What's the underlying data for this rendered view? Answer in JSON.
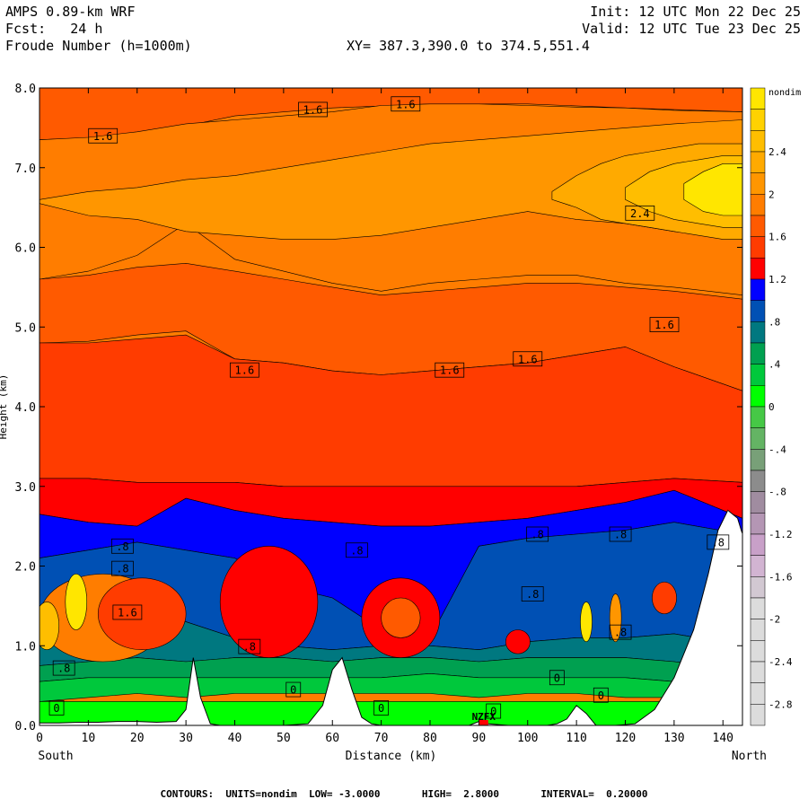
{
  "header": {
    "model": "AMPS 0.89-km WRF",
    "forecast": "Fcst:   24 h",
    "field": "Froude Number (h=1000m)",
    "init": "Init: 12 UTC Mon 22 Dec 25",
    "valid": "Valid: 12 UTC Tue 23 Dec 25",
    "xy": "XY= 387.3,390.0 to 374.5,551.4"
  },
  "chart_data": {
    "type": "heatmap",
    "title": "Froude Number (h=1000m)",
    "xlabel": "Distance (km)",
    "ylabel": "Height (km)",
    "x_ticks": [
      0,
      10,
      20,
      30,
      40,
      50,
      60,
      70,
      80,
      90,
      100,
      110,
      120,
      130,
      140
    ],
    "y_ticks": [
      "0.0",
      "1.0",
      "2.0",
      "3.0",
      "4.0",
      "5.0",
      "6.0",
      "7.0",
      "8.0"
    ],
    "xlim": [
      0,
      144
    ],
    "ylim": [
      0,
      8
    ],
    "left_end_label": "South",
    "right_end_label": "North",
    "station_label": "NZFX",
    "station_x": 91,
    "colorbar": {
      "unit": "nondim",
      "labels": [
        "2.4",
        "2",
        "1.6",
        "1.2",
        ".8",
        ".4",
        "0",
        "-.4",
        "-.8",
        "-1.2",
        "-1.6",
        "-2",
        "-2.4",
        "-2.8"
      ],
      "levels": [
        {
          "value": 2.8,
          "color": "#ffe600"
        },
        {
          "value": 2.6,
          "color": "#ffd200"
        },
        {
          "value": 2.4,
          "color": "#ffbe00"
        },
        {
          "value": 2.2,
          "color": "#ffaa00"
        },
        {
          "value": 2.0,
          "color": "#ff9600"
        },
        {
          "value": 1.8,
          "color": "#ff7d00"
        },
        {
          "value": 1.6,
          "color": "#ff5a00"
        },
        {
          "value": 1.4,
          "color": "#ff3c00"
        },
        {
          "value": 1.2,
          "color": "#ff0000"
        },
        {
          "value": 1.0,
          "color": "#0000ff"
        },
        {
          "value": 0.8,
          "color": "#0050b4"
        },
        {
          "value": 0.6,
          "color": "#007880"
        },
        {
          "value": 0.4,
          "color": "#00a050"
        },
        {
          "value": 0.2,
          "color": "#00c83c"
        },
        {
          "value": 0.0,
          "color": "#00ff00"
        },
        {
          "value": -0.2,
          "color": "#46c846"
        },
        {
          "value": -0.4,
          "color": "#64b464"
        },
        {
          "value": -0.6,
          "color": "#78a078"
        },
        {
          "value": -0.8,
          "color": "#8c8c8c"
        },
        {
          "value": -1.0,
          "color": "#a08ca0"
        },
        {
          "value": -1.2,
          "color": "#b496b4"
        },
        {
          "value": -1.4,
          "color": "#c8a0c8"
        },
        {
          "value": -1.6,
          "color": "#d2b4d2"
        },
        {
          "value": -1.8,
          "color": "#d2c8d2"
        },
        {
          "value": -2.0,
          "color": "#dcdcdc"
        },
        {
          "value": -2.2,
          "color": "#dcdcdc"
        },
        {
          "value": -2.4,
          "color": "#dcdcdc"
        },
        {
          "value": -2.6,
          "color": "#dcdcdc"
        },
        {
          "value": -2.8,
          "color": "#dcdcdc"
        },
        {
          "value": -3.0,
          "color": "#dcdcdc"
        }
      ]
    },
    "bands": [
      {
        "name": "upper-1.6-band",
        "value": 1.6,
        "color": "#ff5a00",
        "x": [
          0,
          20,
          40,
          60,
          80,
          100,
          120,
          144
        ],
        "top": [
          8.0,
          8.0,
          8.0,
          8.0,
          8.0,
          8.0,
          8.0,
          8.0
        ],
        "bottom": [
          7.35,
          7.4,
          7.65,
          7.75,
          7.8,
          7.8,
          7.75,
          7.7
        ]
      },
      {
        "name": "upper-1.8-band",
        "value": 1.8,
        "color": "#ff7d00",
        "x": [
          0,
          10,
          20,
          30,
          40,
          50,
          60,
          70,
          80,
          90,
          100,
          110,
          120,
          130,
          144
        ],
        "top": [
          7.35,
          7.38,
          7.45,
          7.55,
          7.6,
          7.65,
          7.7,
          7.78,
          7.8,
          7.8,
          7.78,
          7.76,
          7.75,
          7.72,
          7.7
        ],
        "bottom": [
          5.6,
          5.7,
          5.9,
          6.3,
          5.85,
          5.7,
          5.55,
          5.45,
          5.55,
          5.6,
          5.65,
          5.65,
          5.55,
          5.5,
          5.4
        ]
      },
      {
        "name": "mid-2.0-band",
        "value": 2.0,
        "color": "#ff9600",
        "x": [
          0,
          10,
          20,
          30,
          40,
          50,
          60,
          70,
          80,
          90,
          100,
          110,
          120,
          130,
          144
        ],
        "top": [
          6.6,
          6.7,
          6.75,
          6.85,
          6.9,
          7.0,
          7.1,
          7.2,
          7.3,
          7.35,
          7.4,
          7.45,
          7.5,
          7.55,
          7.6
        ],
        "bottom": [
          6.55,
          6.4,
          6.35,
          6.2,
          6.15,
          6.1,
          6.1,
          6.15,
          6.25,
          6.35,
          6.45,
          6.35,
          6.3,
          6.2,
          6.1
        ]
      },
      {
        "name": "core-2.2-band",
        "value": 2.2,
        "color": "#ffaa00",
        "x": [
          105,
          110,
          115,
          120,
          125,
          130,
          135,
          140,
          144
        ],
        "top": [
          6.7,
          6.9,
          7.05,
          7.15,
          7.2,
          7.25,
          7.3,
          7.3,
          7.3
        ],
        "bottom": [
          6.6,
          6.5,
          6.35,
          6.3,
          6.25,
          6.2,
          6.15,
          6.1,
          6.1
        ]
      },
      {
        "name": "core-2.4-band",
        "value": 2.4,
        "color": "#ffbe00",
        "x": [
          120,
          125,
          130,
          135,
          140,
          144
        ],
        "top": [
          6.75,
          6.95,
          7.05,
          7.1,
          7.15,
          7.15
        ],
        "bottom": [
          6.6,
          6.45,
          6.35,
          6.3,
          6.25,
          6.25
        ]
      },
      {
        "name": "core-2.8-band",
        "value": 2.8,
        "color": "#ffe600",
        "x": [
          132,
          136,
          140,
          144
        ],
        "top": [
          6.8,
          6.95,
          7.05,
          7.05
        ],
        "bottom": [
          6.6,
          6.45,
          6.4,
          6.4
        ]
      },
      {
        "name": "lower-1.6-band",
        "value": 1.6,
        "color": "#ff5a00",
        "x": [
          0,
          10,
          20,
          30,
          40,
          50,
          60,
          70,
          80,
          90,
          100,
          110,
          120,
          130,
          144
        ],
        "top": [
          5.6,
          5.65,
          5.75,
          5.8,
          5.7,
          5.6,
          5.5,
          5.4,
          5.45,
          5.5,
          5.55,
          5.55,
          5.5,
          5.45,
          5.35
        ],
        "bottom": [
          4.8,
          4.82,
          4.9,
          4.95,
          4.6,
          4.55,
          4.45,
          4.4,
          4.45,
          4.5,
          4.55,
          4.65,
          4.75,
          4.5,
          4.2
        ]
      },
      {
        "name": "lower-1.4-band",
        "value": 1.4,
        "color": "#ff3c00",
        "x": [
          0,
          10,
          20,
          30,
          40,
          50,
          60,
          70,
          80,
          90,
          100,
          110,
          120,
          130,
          144
        ],
        "top": [
          4.8,
          4.8,
          4.85,
          4.9,
          4.6,
          4.55,
          4.45,
          4.4,
          4.45,
          4.5,
          4.55,
          4.65,
          4.75,
          4.5,
          4.2
        ],
        "bottom": [
          3.1,
          3.1,
          3.05,
          3.05,
          3.05,
          3.0,
          3.0,
          3.0,
          3.0,
          3.0,
          3.0,
          3.0,
          3.05,
          3.1,
          3.05
        ]
      },
      {
        "name": "red-1.2-band",
        "value": 1.2,
        "color": "#ff0000",
        "x": [
          0,
          10,
          20,
          30,
          40,
          50,
          60,
          70,
          80,
          90,
          100,
          110,
          120,
          130,
          144
        ],
        "top": [
          3.1,
          3.1,
          3.05,
          3.05,
          3.05,
          3.0,
          3.0,
          3.0,
          3.0,
          3.0,
          3.0,
          3.0,
          3.05,
          3.1,
          3.05
        ],
        "bottom": [
          2.65,
          2.55,
          2.5,
          2.85,
          2.7,
          2.6,
          2.55,
          2.5,
          2.5,
          2.55,
          2.6,
          2.7,
          2.8,
          2.95,
          2.6
        ]
      },
      {
        "name": "blue-1.0-band",
        "value": 1.0,
        "color": "#0000ff",
        "x": [
          0,
          10,
          20,
          30,
          40,
          50,
          60,
          70,
          80,
          90,
          100,
          110,
          120,
          130,
          144
        ],
        "top": [
          2.65,
          2.55,
          2.5,
          2.85,
          2.7,
          2.6,
          2.55,
          2.5,
          2.5,
          2.55,
          2.6,
          2.7,
          2.8,
          2.95,
          2.6
        ],
        "bottom": [
          2.1,
          2.2,
          2.3,
          2.2,
          2.1,
          1.75,
          1.6,
          1.2,
          1.1,
          2.25,
          2.35,
          2.4,
          2.45,
          2.55,
          2.4
        ]
      },
      {
        "name": "mid-blue-0.8-band",
        "value": 0.8,
        "color": "#0050b4",
        "x": [
          0,
          10,
          20,
          30,
          40,
          50,
          60,
          70,
          80,
          90,
          100,
          110,
          120,
          130,
          144
        ],
        "top": [
          2.1,
          2.2,
          2.3,
          2.2,
          2.1,
          1.75,
          1.6,
          1.2,
          1.1,
          2.25,
          2.35,
          2.4,
          2.45,
          2.55,
          2.4
        ],
        "bottom": [
          1.3,
          1.4,
          1.45,
          1.3,
          1.1,
          1.0,
          0.95,
          1.0,
          1.0,
          0.95,
          1.05,
          1.1,
          1.1,
          1.15,
          1.0
        ]
      },
      {
        "name": "teal-0.6-band",
        "value": 0.6,
        "color": "#007880",
        "x": [
          0,
          10,
          20,
          30,
          40,
          50,
          60,
          70,
          80,
          90,
          100,
          110,
          120,
          130,
          144
        ],
        "top": [
          1.3,
          1.4,
          1.45,
          1.3,
          1.1,
          1.0,
          0.95,
          1.0,
          1.0,
          0.95,
          1.05,
          1.1,
          1.1,
          1.15,
          1.0
        ],
        "bottom": [
          0.75,
          0.8,
          0.85,
          0.8,
          0.85,
          0.85,
          0.8,
          0.85,
          0.85,
          0.8,
          0.85,
          0.85,
          0.85,
          0.8,
          0.7
        ]
      },
      {
        "name": "green-0.4-band",
        "value": 0.4,
        "color": "#00a050",
        "x": [
          0,
          10,
          20,
          30,
          40,
          50,
          60,
          70,
          80,
          90,
          100,
          110,
          120,
          130,
          144
        ],
        "top": [
          0.75,
          0.8,
          0.85,
          0.8,
          0.85,
          0.85,
          0.8,
          0.85,
          0.85,
          0.8,
          0.85,
          0.85,
          0.85,
          0.8,
          0.7
        ],
        "bottom": [
          0.55,
          0.6,
          0.6,
          0.6,
          0.6,
          0.6,
          0.6,
          0.6,
          0.65,
          0.6,
          0.6,
          0.6,
          0.6,
          0.55,
          0.5
        ]
      },
      {
        "name": "green-0.2-band",
        "value": 0.2,
        "color": "#00c83c",
        "x": [
          0,
          10,
          20,
          30,
          40,
          50,
          60,
          70,
          80,
          90,
          100,
          110,
          120,
          130,
          144
        ],
        "top": [
          0.55,
          0.6,
          0.6,
          0.6,
          0.6,
          0.6,
          0.6,
          0.6,
          0.65,
          0.6,
          0.6,
          0.6,
          0.6,
          0.55,
          0.5
        ],
        "bottom": [
          0.3,
          0.35,
          0.4,
          0.35,
          0.4,
          0.4,
          0.4,
          0.4,
          0.4,
          0.35,
          0.4,
          0.4,
          0.35,
          0.35,
          0.3
        ]
      },
      {
        "name": "green-0.0-band",
        "value": 0.0,
        "color": "#00ff00",
        "x": [
          0,
          144
        ],
        "top": [
          0.3,
          0.3
        ],
        "bottom": [
          0.0,
          0.0
        ]
      }
    ],
    "blobs": [
      {
        "name": "south-orange-blob",
        "value": 1.8,
        "color": "#ff7d00",
        "cx": 13,
        "cy": 1.35,
        "rx": 13,
        "ry": 0.55
      },
      {
        "name": "south-red-blob",
        "value": 1.4,
        "color": "#ff3c00",
        "cx": 21,
        "cy": 1.4,
        "rx": 9,
        "ry": 0.45
      },
      {
        "name": "south-yellow-core",
        "value": 2.8,
        "color": "#ffe600",
        "cx": 7.5,
        "cy": 1.55,
        "rx": 2.2,
        "ry": 0.35
      },
      {
        "name": "south-amber-core",
        "value": 2.4,
        "color": "#ffbe00",
        "cx": 1.5,
        "cy": 1.25,
        "rx": 2.5,
        "ry": 0.3
      },
      {
        "name": "mid-orange-blob",
        "value": 1.6,
        "color": "#ff5a00",
        "cx": 47,
        "cy": 1.65,
        "rx": 8,
        "ry": 0.55
      },
      {
        "name": "mid-red-blob",
        "value": 1.2,
        "color": "#ff0000",
        "cx": 47,
        "cy": 1.55,
        "rx": 10,
        "ry": 0.7
      },
      {
        "name": "centre-red-blob",
        "value": 1.2,
        "color": "#ff0000",
        "cx": 74,
        "cy": 1.35,
        "rx": 8,
        "ry": 0.5
      },
      {
        "name": "centre-orange-blob",
        "value": 1.6,
        "color": "#ff5a00",
        "cx": 74,
        "cy": 1.35,
        "rx": 4,
        "ry": 0.25
      },
      {
        "name": "north-red-blob",
        "value": 1.2,
        "color": "#ff0000",
        "cx": 98,
        "cy": 1.05,
        "rx": 2.5,
        "ry": 0.15
      },
      {
        "name": "north-yellow-core",
        "value": 2.8,
        "color": "#ffe600",
        "cx": 112,
        "cy": 1.3,
        "rx": 1.2,
        "ry": 0.25
      },
      {
        "name": "north-orange-core",
        "value": 2.0,
        "color": "#ff9600",
        "cx": 118,
        "cy": 1.35,
        "rx": 1.2,
        "ry": 0.3
      },
      {
        "name": "far-north-red-blob",
        "value": 1.4,
        "color": "#ff3c00",
        "cx": 128,
        "cy": 1.6,
        "rx": 2.5,
        "ry": 0.2
      }
    ],
    "terrain": {
      "x": [
        0,
        4,
        8,
        12,
        16,
        20,
        24,
        28,
        30,
        31.5,
        33,
        35,
        37,
        40,
        45,
        50,
        55,
        58,
        60,
        62,
        64,
        66,
        68,
        70,
        72,
        76,
        80,
        84,
        88,
        90,
        92,
        96,
        100,
        104,
        106,
        108,
        110,
        112,
        114,
        118,
        122,
        126,
        130,
        134,
        137,
        139,
        141,
        143,
        144
      ],
      "y": [
        0.03,
        0.03,
        0.04,
        0.04,
        0.05,
        0.05,
        0.04,
        0.05,
        0.2,
        0.85,
        0.35,
        0.02,
        0.0,
        0.0,
        0.0,
        0.0,
        0.02,
        0.25,
        0.7,
        0.85,
        0.45,
        0.1,
        0.02,
        0.0,
        0.0,
        0.0,
        0.0,
        0.0,
        0.0,
        0.05,
        0.02,
        0.0,
        0.0,
        0.0,
        0.02,
        0.08,
        0.25,
        0.15,
        0.0,
        0.0,
        0.02,
        0.2,
        0.6,
        1.2,
        1.9,
        2.45,
        2.7,
        2.6,
        2.4
      ]
    },
    "contour_labels": [
      {
        "text": "1.6",
        "x": 13,
        "y": 7.4
      },
      {
        "text": "1.6",
        "x": 56,
        "y": 7.73
      },
      {
        "text": "1.6",
        "x": 75,
        "y": 7.8
      },
      {
        "text": "2.4",
        "x": 123,
        "y": 6.43
      },
      {
        "text": "1.6",
        "x": 128,
        "y": 5.03
      },
      {
        "text": "1.6",
        "x": 42,
        "y": 4.46
      },
      {
        "text": "1.6",
        "x": 84,
        "y": 4.46
      },
      {
        "text": "1.6",
        "x": 100,
        "y": 4.6
      },
      {
        "text": ".8",
        "x": 17,
        "y": 2.25
      },
      {
        "text": ".8",
        "x": 17,
        "y": 1.97
      },
      {
        "text": ".8",
        "x": 65,
        "y": 2.2
      },
      {
        "text": ".8",
        "x": 102,
        "y": 2.4
      },
      {
        "text": ".8",
        "x": 119,
        "y": 2.4
      },
      {
        "text": ".8",
        "x": 139,
        "y": 2.3
      },
      {
        "text": ".8",
        "x": 101,
        "y": 1.65
      },
      {
        "text": ".8",
        "x": 43,
        "y": 0.99
      },
      {
        "text": ".8",
        "x": 119,
        "y": 1.17
      },
      {
        "text": ".8",
        "x": 5,
        "y": 0.72
      },
      {
        "text": "1.6",
        "x": 18,
        "y": 1.42
      },
      {
        "text": "0",
        "x": 3.5,
        "y": 0.22
      },
      {
        "text": "0",
        "x": 52,
        "y": 0.45
      },
      {
        "text": "0",
        "x": 70,
        "y": 0.22
      },
      {
        "text": "0",
        "x": 93,
        "y": 0.18
      },
      {
        "text": "0",
        "x": 106,
        "y": 0.6
      },
      {
        "text": "0",
        "x": 115,
        "y": 0.38
      }
    ]
  },
  "footer": {
    "text": "CONTOURS:  UNITS=nondim  LOW= -3.0000       HIGH=  2.8000       INTERVAL=  0.20000"
  }
}
